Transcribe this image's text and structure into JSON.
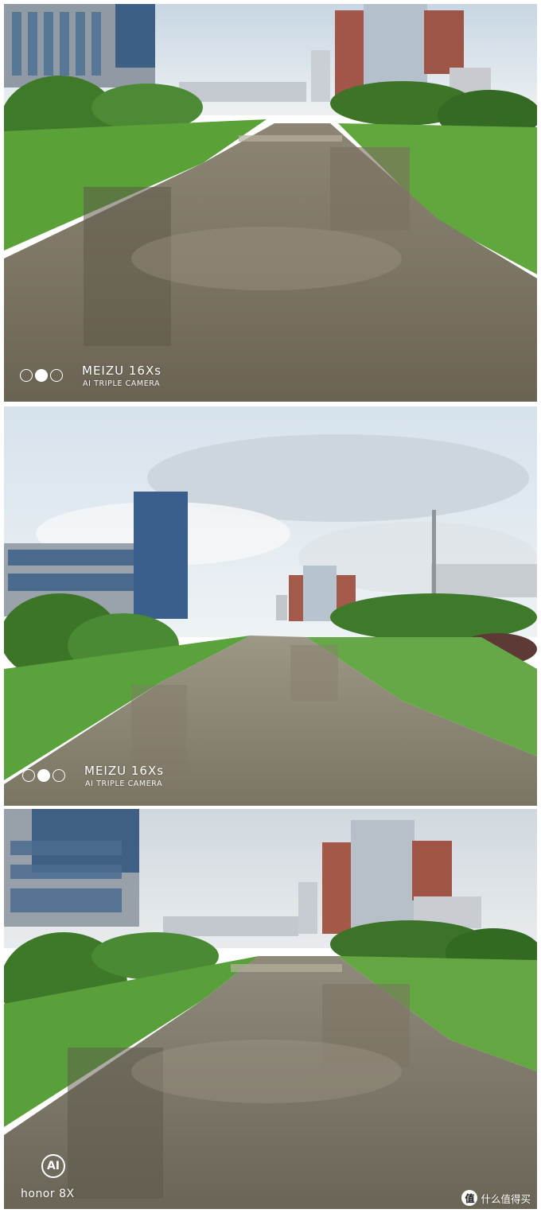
{
  "photos": [
    {
      "watermark": {
        "brand": "MEIZU 16Xs",
        "subtitle": "AI TRIPLE CAMERA"
      }
    },
    {
      "watermark": {
        "brand": "MEIZU 16Xs",
        "subtitle": "AI TRIPLE CAMERA"
      }
    },
    {
      "watermark": {
        "badge": "AI",
        "brand": "honor 8X"
      }
    }
  ],
  "site_watermark": {
    "logo": "值",
    "text": "什么值得买"
  },
  "colors": {
    "sky": "#d9e3ea",
    "sky_blue": "#b9d0e6",
    "grass": "#5a9e3a",
    "water": "#7a7464",
    "building": "#a9b3bd",
    "brick": "#a45a4a",
    "tree": "#3f7a2a"
  }
}
